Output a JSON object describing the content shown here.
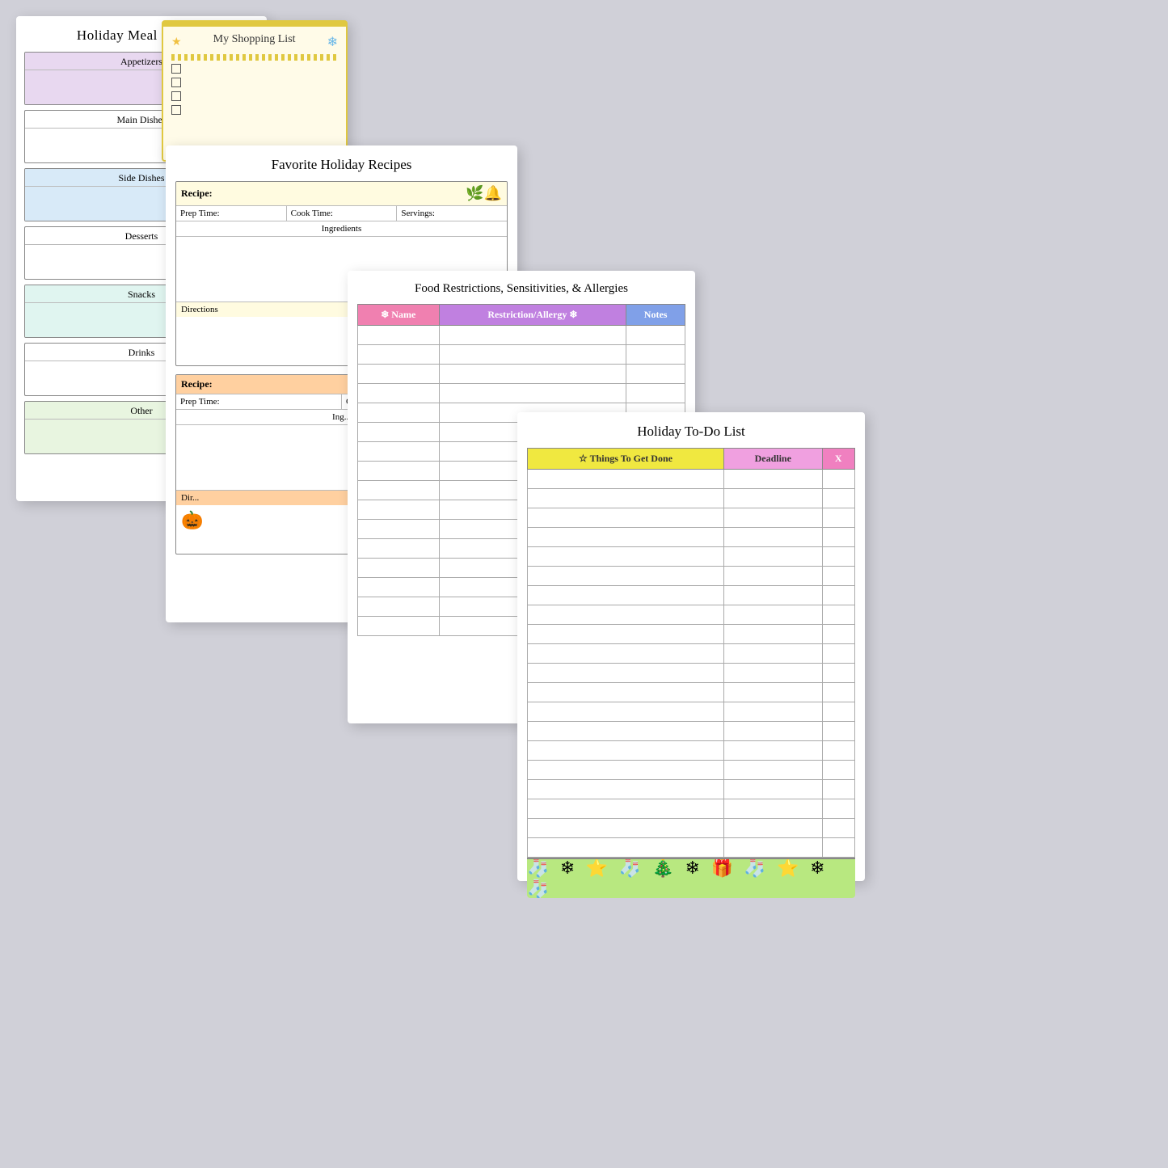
{
  "mealPlanner": {
    "title": "Holiday Meal Planner",
    "sections": [
      {
        "label": "Appetizers",
        "bg": "appetizers-bg"
      },
      {
        "label": "Main Dishes",
        "bg": "main-dishes-bg"
      },
      {
        "label": "Side Dishes",
        "bg": "side-dishes-bg"
      },
      {
        "label": "Desserts",
        "bg": "desserts-bg"
      },
      {
        "label": "Snacks",
        "bg": "snacks-bg"
      },
      {
        "label": "Drinks",
        "bg": "drinks-bg"
      },
      {
        "label": "Other",
        "bg": "other-bg"
      }
    ]
  },
  "shoppingList": {
    "title": "✦ My Shopping List ❄",
    "items": [
      "",
      "",
      "",
      "",
      ""
    ]
  },
  "recipes": {
    "title": "Favorite Holiday Recipes",
    "recipe1": {
      "bg": "recipe-top-yellow",
      "recipeLabel": "Recipe:",
      "prepLabel": "Prep Time:",
      "cookLabel": "Cook Time:",
      "servingsLabel": "Servings:",
      "ingredientsLabel": "Ingredients",
      "directionsLabel": "Directions"
    },
    "recipe2": {
      "bg": "recipe-top-orange",
      "recipeLabel": "Recipe:",
      "prepLabel": "Prep Time:",
      "cookLabel": "Cook Ti...",
      "ingredientsLabel": "Ing...",
      "directionsLabel": "Dir..."
    }
  },
  "foodRestrictions": {
    "title": "Food Restrictions, Sensitivities, & Allergies",
    "columns": [
      "❄ Name ❄",
      "Restriction/Allergy ❄",
      "Notes"
    ],
    "rows": 16
  },
  "todoList": {
    "title": "Holiday To-Do List",
    "columns": [
      "☆  Things To Get Done",
      "Deadline",
      "X"
    ],
    "rows": 20,
    "footerEmojis": "🧦 ❄ ⭐ 🧦 🎄 ❄ 🎁 🧦 ⭐ ❄"
  }
}
